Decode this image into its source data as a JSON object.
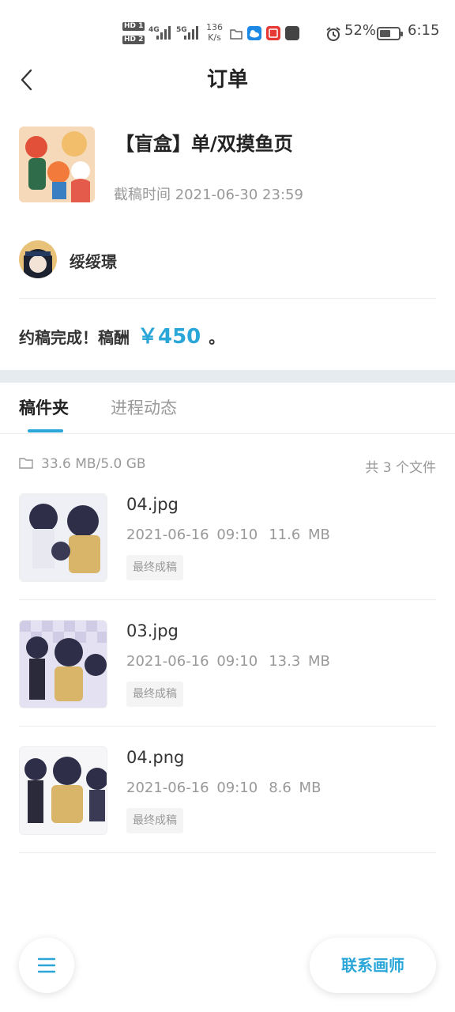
{
  "status_bar": {
    "hd1": "HD 1",
    "hd2": "HD 2",
    "net1": "4G",
    "net2": "5G",
    "speed_value": "136",
    "speed_unit": "K/s",
    "battery": "52%",
    "time": "6:15"
  },
  "header": {
    "title": "订单",
    "back_icon": "chevron-left-icon"
  },
  "product": {
    "title": "【盲盒】单/双摸鱼页",
    "deadline": "截稿时间 2021-06-30 23:59"
  },
  "artist": {
    "name": "绥绥璟"
  },
  "completion": {
    "text": "约稿完成！稿酬",
    "price": "￥450",
    "suffix": "。"
  },
  "tabs": [
    {
      "label": "稿件夹",
      "active": true
    },
    {
      "label": "进程动态",
      "active": false
    }
  ],
  "folder": {
    "storage": "33.6 MB/5.0 GB",
    "count": "共 3 个文件"
  },
  "files": [
    {
      "name": "04.jpg",
      "date": "2021-06-16 09:10",
      "size": "11.6 MB",
      "tag": "最终成稿"
    },
    {
      "name": "03.jpg",
      "date": "2021-06-16 09:10",
      "size": "13.3 MB",
      "tag": "最终成稿"
    },
    {
      "name": "04.png",
      "date": "2021-06-16 09:10",
      "size": "8.6 MB",
      "tag": "最终成稿"
    }
  ],
  "actions": {
    "menu_icon": "menu-icon",
    "contact_label": "联系画师"
  },
  "colors": {
    "accent": "#2aa6d8",
    "band": "#e6ebf0"
  }
}
